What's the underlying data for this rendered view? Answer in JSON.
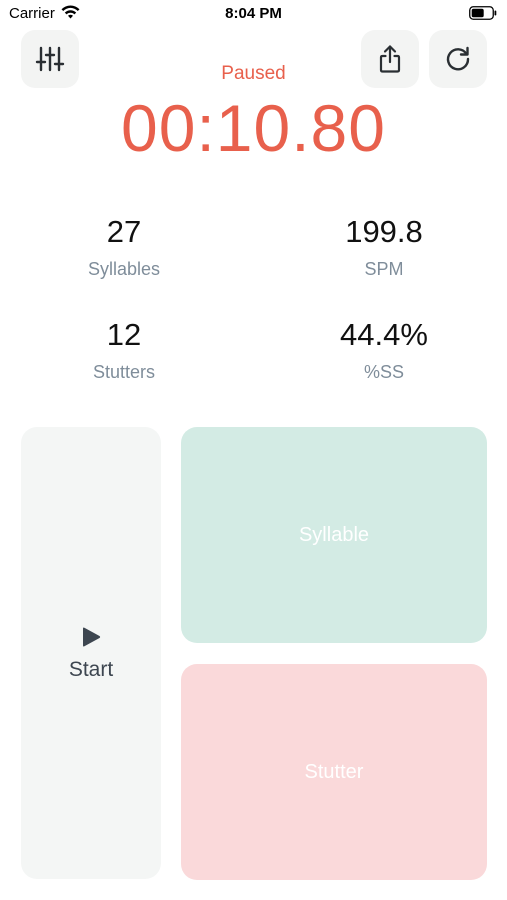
{
  "status_bar": {
    "carrier": "Carrier",
    "time": "8:04 PM",
    "wifi_icon": "wifi-icon",
    "battery_icon": "battery-icon"
  },
  "toolbar": {
    "settings_icon": "sliders-icon",
    "share_icon": "share-icon",
    "reset_icon": "refresh-icon"
  },
  "timer": {
    "state": "Paused",
    "display": "00:10.80"
  },
  "stats": {
    "syllables": {
      "value": "27",
      "label": "Syllables"
    },
    "spm": {
      "value": "199.8",
      "label": "SPM"
    },
    "stutters": {
      "value": "12",
      "label": "Stutters"
    },
    "percent_ss": {
      "value": "44.4%",
      "label": "%SS"
    }
  },
  "pads": {
    "start_label": "Start",
    "start_icon": "play-icon",
    "syllable_label": "Syllable",
    "stutter_label": "Stutter"
  },
  "colors": {
    "accent": "#e8604c",
    "syllable_pad": "#d3ebe4",
    "stutter_pad": "#fad9da",
    "start_pad": "#f4f6f5",
    "muted_label": "#7f8d9a"
  }
}
